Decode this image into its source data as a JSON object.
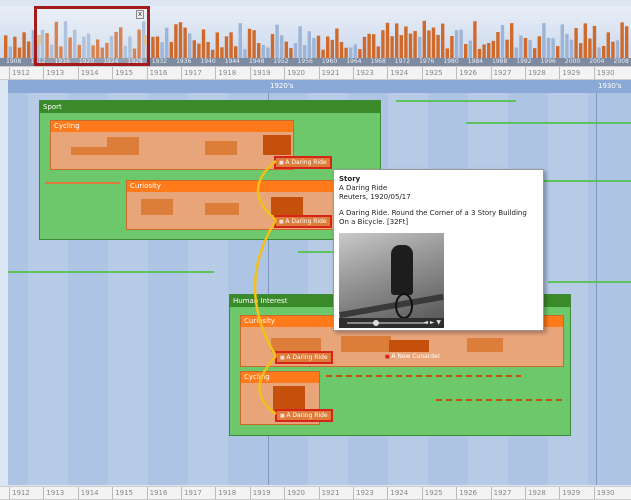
{
  "overview": {
    "years": [
      "1908",
      "1912",
      "1916",
      "1920",
      "1924",
      "1928",
      "1932",
      "1936",
      "1940",
      "1944",
      "1948",
      "1952",
      "1956",
      "1960",
      "1964",
      "1968",
      "1972",
      "1976",
      "1980",
      "1984",
      "1988",
      "1992",
      "1996",
      "2000",
      "2004",
      "2008"
    ],
    "window_years": [
      "1912",
      "1916",
      "1920",
      "1924"
    ],
    "close_label": "x",
    "colors": {
      "bar": "#d06a2c",
      "bar_faint": "#9db4d6",
      "window": "#a31b1b"
    }
  },
  "ruler": {
    "years": [
      "1912",
      "1913",
      "1914",
      "1915",
      "1916",
      "1917",
      "1918",
      "1919",
      "1920",
      "1921",
      "1923",
      "1924",
      "1925",
      "1926",
      "1927",
      "1928",
      "1929",
      "1930"
    ]
  },
  "timeline": {
    "decades": [
      "1920's",
      "1930's"
    ],
    "categories": [
      {
        "title": "Sport",
        "subs": [
          {
            "title": "Cycling",
            "story": "A Daring Ride"
          },
          {
            "title": "Curiosity",
            "story": "A Daring Ride"
          }
        ]
      },
      {
        "title": "Human Interest",
        "subs": [
          {
            "title": "Curiosity",
            "story": "A Daring Ride",
            "story2": "A New Cunarder"
          },
          {
            "title": "Cycling",
            "story": "A Daring Ride"
          }
        ]
      }
    ]
  },
  "popup": {
    "type": "Story",
    "title": "A Daring Ride",
    "source": "Reuters, 1920/05/17",
    "description": "A Daring Ride. Round the Corner of a 3 Story Building On a Bicycle. [32Ft]",
    "video_controls": "◄ ► ▼"
  }
}
